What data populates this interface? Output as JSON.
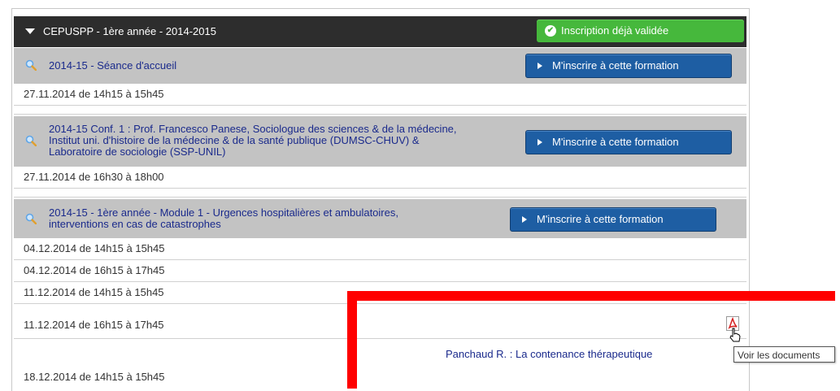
{
  "header": {
    "title": "CEPUSPP - 1ère année - 2014-2015",
    "status_label": "Inscription déjà validée"
  },
  "courses": [
    {
      "title": "2014-15 - Séance d'accueil",
      "button_label": "M'inscrire à cette formation",
      "sessions": [
        "27.11.2014 de 14h15 à 15h45"
      ]
    },
    {
      "title_lines": [
        "2014-15 Conf. 1 : Prof. Francesco Panese, Sociologue des sciences & de la médecine,",
        "Institut uni. d'histoire de la médecine & de la santé publique (DUMSC-CHUV) &",
        "Laboratoire de sociologie (SSP-UNIL)"
      ],
      "button_label": "M'inscrire à cette formation",
      "sessions": [
        "27.11.2014 de 16h30 à 18h00"
      ]
    },
    {
      "title_lines": [
        "2014-15 - 1ère année - Module 1 - Urgences hospitalières et ambulatoires,",
        "interventions en cas de catastrophes"
      ],
      "button_label": "M'inscrire à cette formation",
      "sessions": [
        "04.12.2014 de 14h15 à 15h45",
        "04.12.2014 de 16h15 à 17h45",
        "11.12.2014 de 14h15 à 15h45",
        "11.12.2014 de 16h15 à 17h45",
        "18.12.2014 de 14h15 à 15h45"
      ]
    }
  ],
  "document": {
    "title": "Panchaud R. : La contenance thérapeutique",
    "tooltip": "Voir les documents"
  },
  "colors": {
    "header_bg": "#2d2d2d",
    "validated_green": "#46b83c",
    "course_bg": "#c3c3c3",
    "button_blue": "#1e5ea3",
    "link_blue": "#1a2a8c",
    "highlight_red": "#ff0000"
  },
  "icons": [
    "chevron-down-icon",
    "check-circle-icon",
    "search-icon",
    "play-arrow-icon",
    "pdf-icon",
    "hand-cursor-icon"
  ]
}
